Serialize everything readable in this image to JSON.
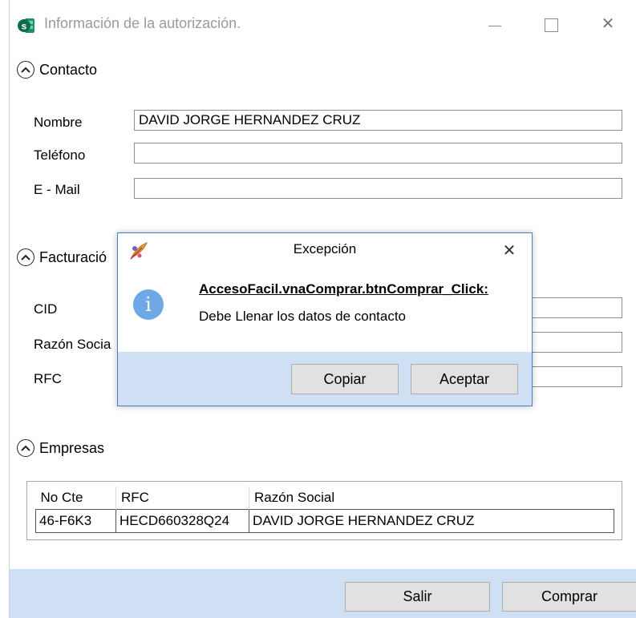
{
  "window": {
    "title": "Información de la autorización.",
    "controls": {
      "minimize": "—",
      "maximize": "☐",
      "close": "✕"
    }
  },
  "contacto": {
    "header": "Contacto",
    "fields": [
      {
        "label": "Nombre",
        "value": "DAVID JORGE HERNANDEZ CRUZ"
      },
      {
        "label": "Teléfono",
        "value": ""
      },
      {
        "label": "E - Mail",
        "value": ""
      }
    ]
  },
  "facturacion": {
    "header": "Facturació",
    "fields": [
      {
        "label": "CID",
        "value": ""
      },
      {
        "label": "Razón Socia",
        "value": ""
      },
      {
        "label": "RFC",
        "value": ""
      }
    ]
  },
  "empresas": {
    "header": "Empresas",
    "columns": [
      "No Cte",
      "RFC",
      "Razón Social"
    ],
    "rows": [
      [
        "46-F6K3",
        "HECD660328Q24",
        "DAVID JORGE HERNANDEZ CRUZ"
      ]
    ]
  },
  "footer": {
    "salir": "Salir",
    "comprar": "Comprar"
  },
  "dialog": {
    "title": "Excepción",
    "close": "✕",
    "info_glyph": "i",
    "heading": "AccesoFacil.vnaComprar.btnComprar_Click:",
    "message": "Debe Llenar los datos de contacto",
    "copiar": "Copiar",
    "aceptar": "Aceptar"
  },
  "colors": {
    "footer_bg": "#cfe0f4",
    "dialog_border": "#4f7cc0",
    "info_icon": "#6ea8e6",
    "app_icon": "#1e8f6e"
  },
  "icons": {
    "app": "app-logo-icon",
    "section_toggle": "chevron-up-icon",
    "dialog": "feather-icon",
    "info": "info-icon"
  }
}
